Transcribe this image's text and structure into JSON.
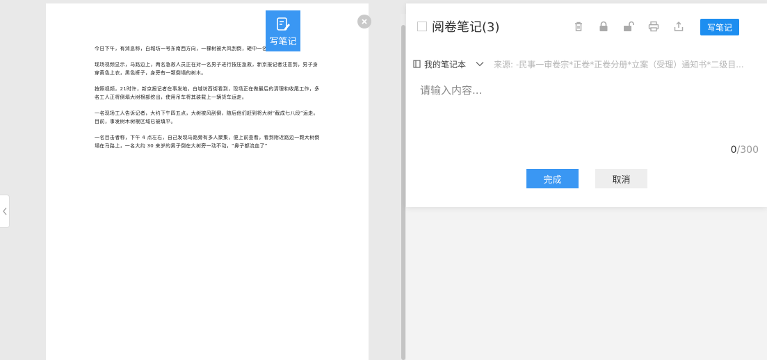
{
  "document": {
    "paragraphs": [
      "今日下午，有消息称，白城坊一号东南西方向，一棵树被大风刮倒，砸中一名外卖骑手。",
      "现场视频显示，马路边上，两名急救人员正在对一名男子进行按压急救，新京报记者注意到，男子身穿黄色上衣，黑色裤子，身旁有一颗倒塌的树木。",
      "按照视频，21时许，新京报记者在事发地，白城坊西街看到，现场正在做最后的清理和收尾工作，多名工人正将倒塌大树根部挖出，使用吊车将其装载上一辆货车运走。",
      "一名现场工人告诉记者，大约下午四五点，大树被风刮倒，随后他们赶到将大树“截成七八段”运走。目前，事发树木树根区域已被填平。",
      "一名目击者称，下午 4 点左右，自己发现马路旁有多人聚集，便上前查看，看到附近路边一颗大树倒塌在马路上，一名大约 30 来岁的男子倒在大树旁一动不动，“鼻子都流血了”"
    ]
  },
  "float_button": {
    "label": "写笔记",
    "icon": "edit-note-icon"
  },
  "close_icon": "close-icon",
  "collapse_icon": "chevron-left-icon",
  "notes": {
    "title": "阅卷笔记(3)",
    "toolbar_icons": [
      "trash-icon",
      "lock-icon",
      "unlock-icon",
      "print-icon",
      "export-icon"
    ],
    "write_button": "写笔记",
    "notebook_label": "我的笔记本",
    "source_text": "来源: -民事一审卷宗*正卷*正卷分册*立案（受理）通知书*二级目...",
    "placeholder": "请输入内容...",
    "counter_current": "0",
    "counter_max": "/300",
    "confirm_label": "完成",
    "cancel_label": "取消"
  },
  "colors": {
    "accent": "#3a97f3",
    "write_btn": "#1d8ef0"
  }
}
